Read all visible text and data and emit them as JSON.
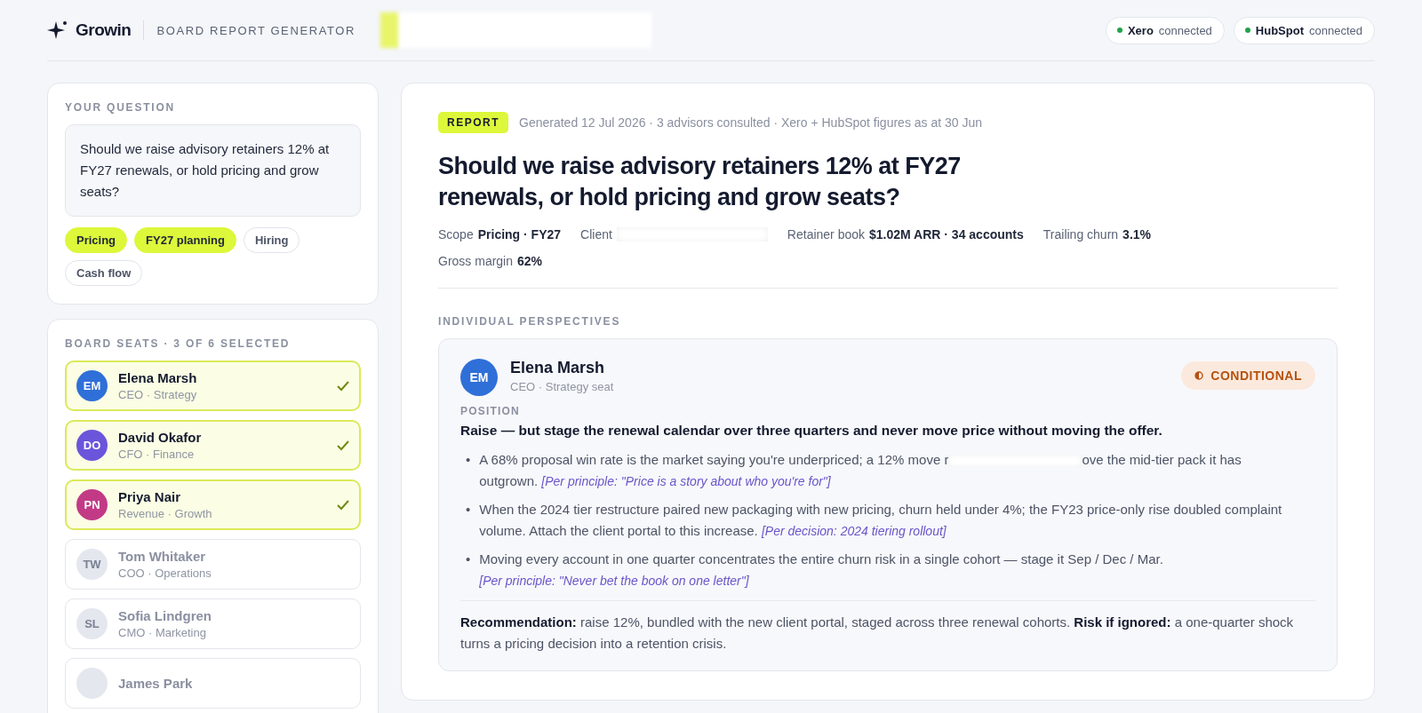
{
  "header": {
    "brand": "Growin",
    "product": "BOARD REPORT GENERATOR",
    "integrations": [
      {
        "name": "Xero",
        "status": "connected",
        "connected": true
      },
      {
        "name": "HubSpot",
        "status": "connected",
        "connected": true
      }
    ]
  },
  "question_panel": {
    "heading": "YOUR QUESTION",
    "question": "Should we raise advisory retainers 12% at FY27 renewals, or hold pricing and grow seats?",
    "tags": [
      {
        "label": "Pricing",
        "selected": true
      },
      {
        "label": "FY27 planning",
        "selected": true
      },
      {
        "label": "Hiring",
        "selected": false
      },
      {
        "label": "Cash flow",
        "selected": false
      }
    ]
  },
  "seats_panel": {
    "heading": "BOARD SEATS · 3 OF 6 SELECTED",
    "seats": [
      {
        "initials": "EM",
        "name": "Elena Marsh",
        "role": "CEO · Strategy",
        "selected": true,
        "color": "#2f6fd8"
      },
      {
        "initials": "DO",
        "name": "David Okafor",
        "role": "CFO · Finance",
        "selected": true,
        "color": "#6b55db"
      },
      {
        "initials": "PN",
        "name": "Priya Nair",
        "role": "Revenue · Growth",
        "selected": true,
        "color": "#c23a86"
      },
      {
        "initials": "TW",
        "name": "Tom Whitaker",
        "role": "COO · Operations",
        "selected": false,
        "color": "#e4e7ee"
      },
      {
        "initials": "SL",
        "name": "Sofia Lindgren",
        "role": "CMO · Marketing",
        "selected": false,
        "color": "#e4e7ee"
      },
      {
        "name": "James Park",
        "selected": false,
        "color": "#e4e7ee"
      }
    ]
  },
  "report": {
    "badge": "REPORT",
    "meta": "Generated 12 Jul 2026 · 3 advisors consulted · Xero + HubSpot figures as at 30 Jun",
    "title": "Should we raise advisory retainers 12% at FY27 renewals, or hold pricing and grow seats?",
    "facts": [
      {
        "label": "Scope",
        "value": "Pricing · FY27"
      },
      {
        "label": "Client",
        "redacted": true
      },
      {
        "label": "Retainer book",
        "value": "$1.02M ARR · 34 accounts"
      },
      {
        "label": "Trailing churn",
        "value": "3.1%"
      },
      {
        "label": "Gross margin",
        "value": "62%"
      }
    ],
    "section_heading": "INDIVIDUAL PERSPECTIVES",
    "perspectives": [
      {
        "initials": "EM",
        "color": "#2f6fd8",
        "name": "Elena Marsh",
        "seat": "CEO · Strategy seat",
        "stance": {
          "kind": "conditional",
          "label": "CONDITIONAL"
        },
        "position_label": "POSITION",
        "position": "Raise — but stage the renewal calendar over three quarters and never move price without moving the offer.",
        "points": [
          {
            "marker": "•",
            "text": "A 68% proposal win rate is the market saying you're underpriced; a 12% move r",
            "redacted": true,
            "text_after": "ove the mid-tier pack it has outgrown.",
            "citation": "[Per principle: \"Price is a story about who you're for\"]"
          },
          {
            "marker": "•",
            "text": "When the 2024 tier restructure paired new packaging with new pricing, churn held under 4%; the FY23 price-only rise doubled complaint volume. Attach the client portal to this increase.",
            "citation": "[Per decision: 2024 tiering rollout]"
          },
          {
            "marker": "•",
            "text": "Moving every account in one quarter concentrates the entire churn risk in a single cohort — stage it Sep / Dec / Mar.",
            "citation": "[Per principle: \"Never bet the book on one letter\"]"
          }
        ],
        "summary": "**Recommendation:** raise 12%, bundled with the new client portal, staged across three renewal cohorts. **Risk if ignored:** a one-quarter shock turns a pricing decision into a retention crisis."
      }
    ]
  }
}
